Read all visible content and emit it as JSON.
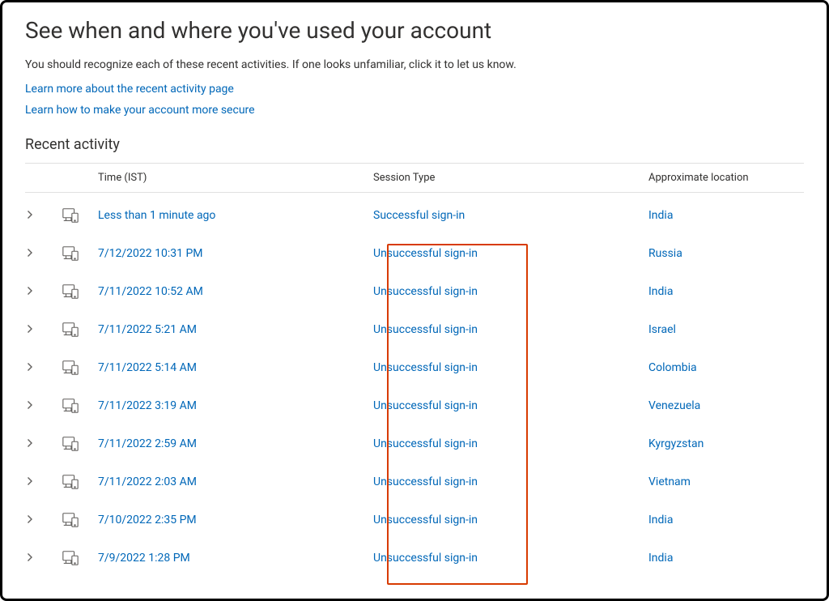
{
  "header": {
    "title": "See when and where you've used your account",
    "subtitle": "You should recognize each of these recent activities. If one looks unfamiliar, click it to let us know.",
    "links": [
      "Learn more about the recent activity page",
      "Learn how to make your account more secure"
    ]
  },
  "section_title": "Recent activity",
  "columns": {
    "time": "Time (IST)",
    "session": "Session Type",
    "location": "Approximate location"
  },
  "activities": [
    {
      "time": "Less than 1 minute ago",
      "session": "Successful sign-in",
      "location": "India"
    },
    {
      "time": "7/12/2022 10:31 PM",
      "session": "Unsuccessful sign-in",
      "location": "Russia"
    },
    {
      "time": "7/11/2022 10:52 AM",
      "session": "Unsuccessful sign-in",
      "location": "India"
    },
    {
      "time": "7/11/2022 5:21 AM",
      "session": "Unsuccessful sign-in",
      "location": "Israel"
    },
    {
      "time": "7/11/2022 5:14 AM",
      "session": "Unsuccessful sign-in",
      "location": "Colombia"
    },
    {
      "time": "7/11/2022 3:19 AM",
      "session": "Unsuccessful sign-in",
      "location": "Venezuela"
    },
    {
      "time": "7/11/2022 2:59 AM",
      "session": "Unsuccessful sign-in",
      "location": "Kyrgyzstan"
    },
    {
      "time": "7/11/2022 2:03 AM",
      "session": "Unsuccessful sign-in",
      "location": "Vietnam"
    },
    {
      "time": "7/10/2022 2:35 PM",
      "session": "Unsuccessful sign-in",
      "location": "India"
    },
    {
      "time": "7/9/2022 1:28 PM",
      "session": "Unsuccessful sign-in",
      "location": "India"
    }
  ]
}
